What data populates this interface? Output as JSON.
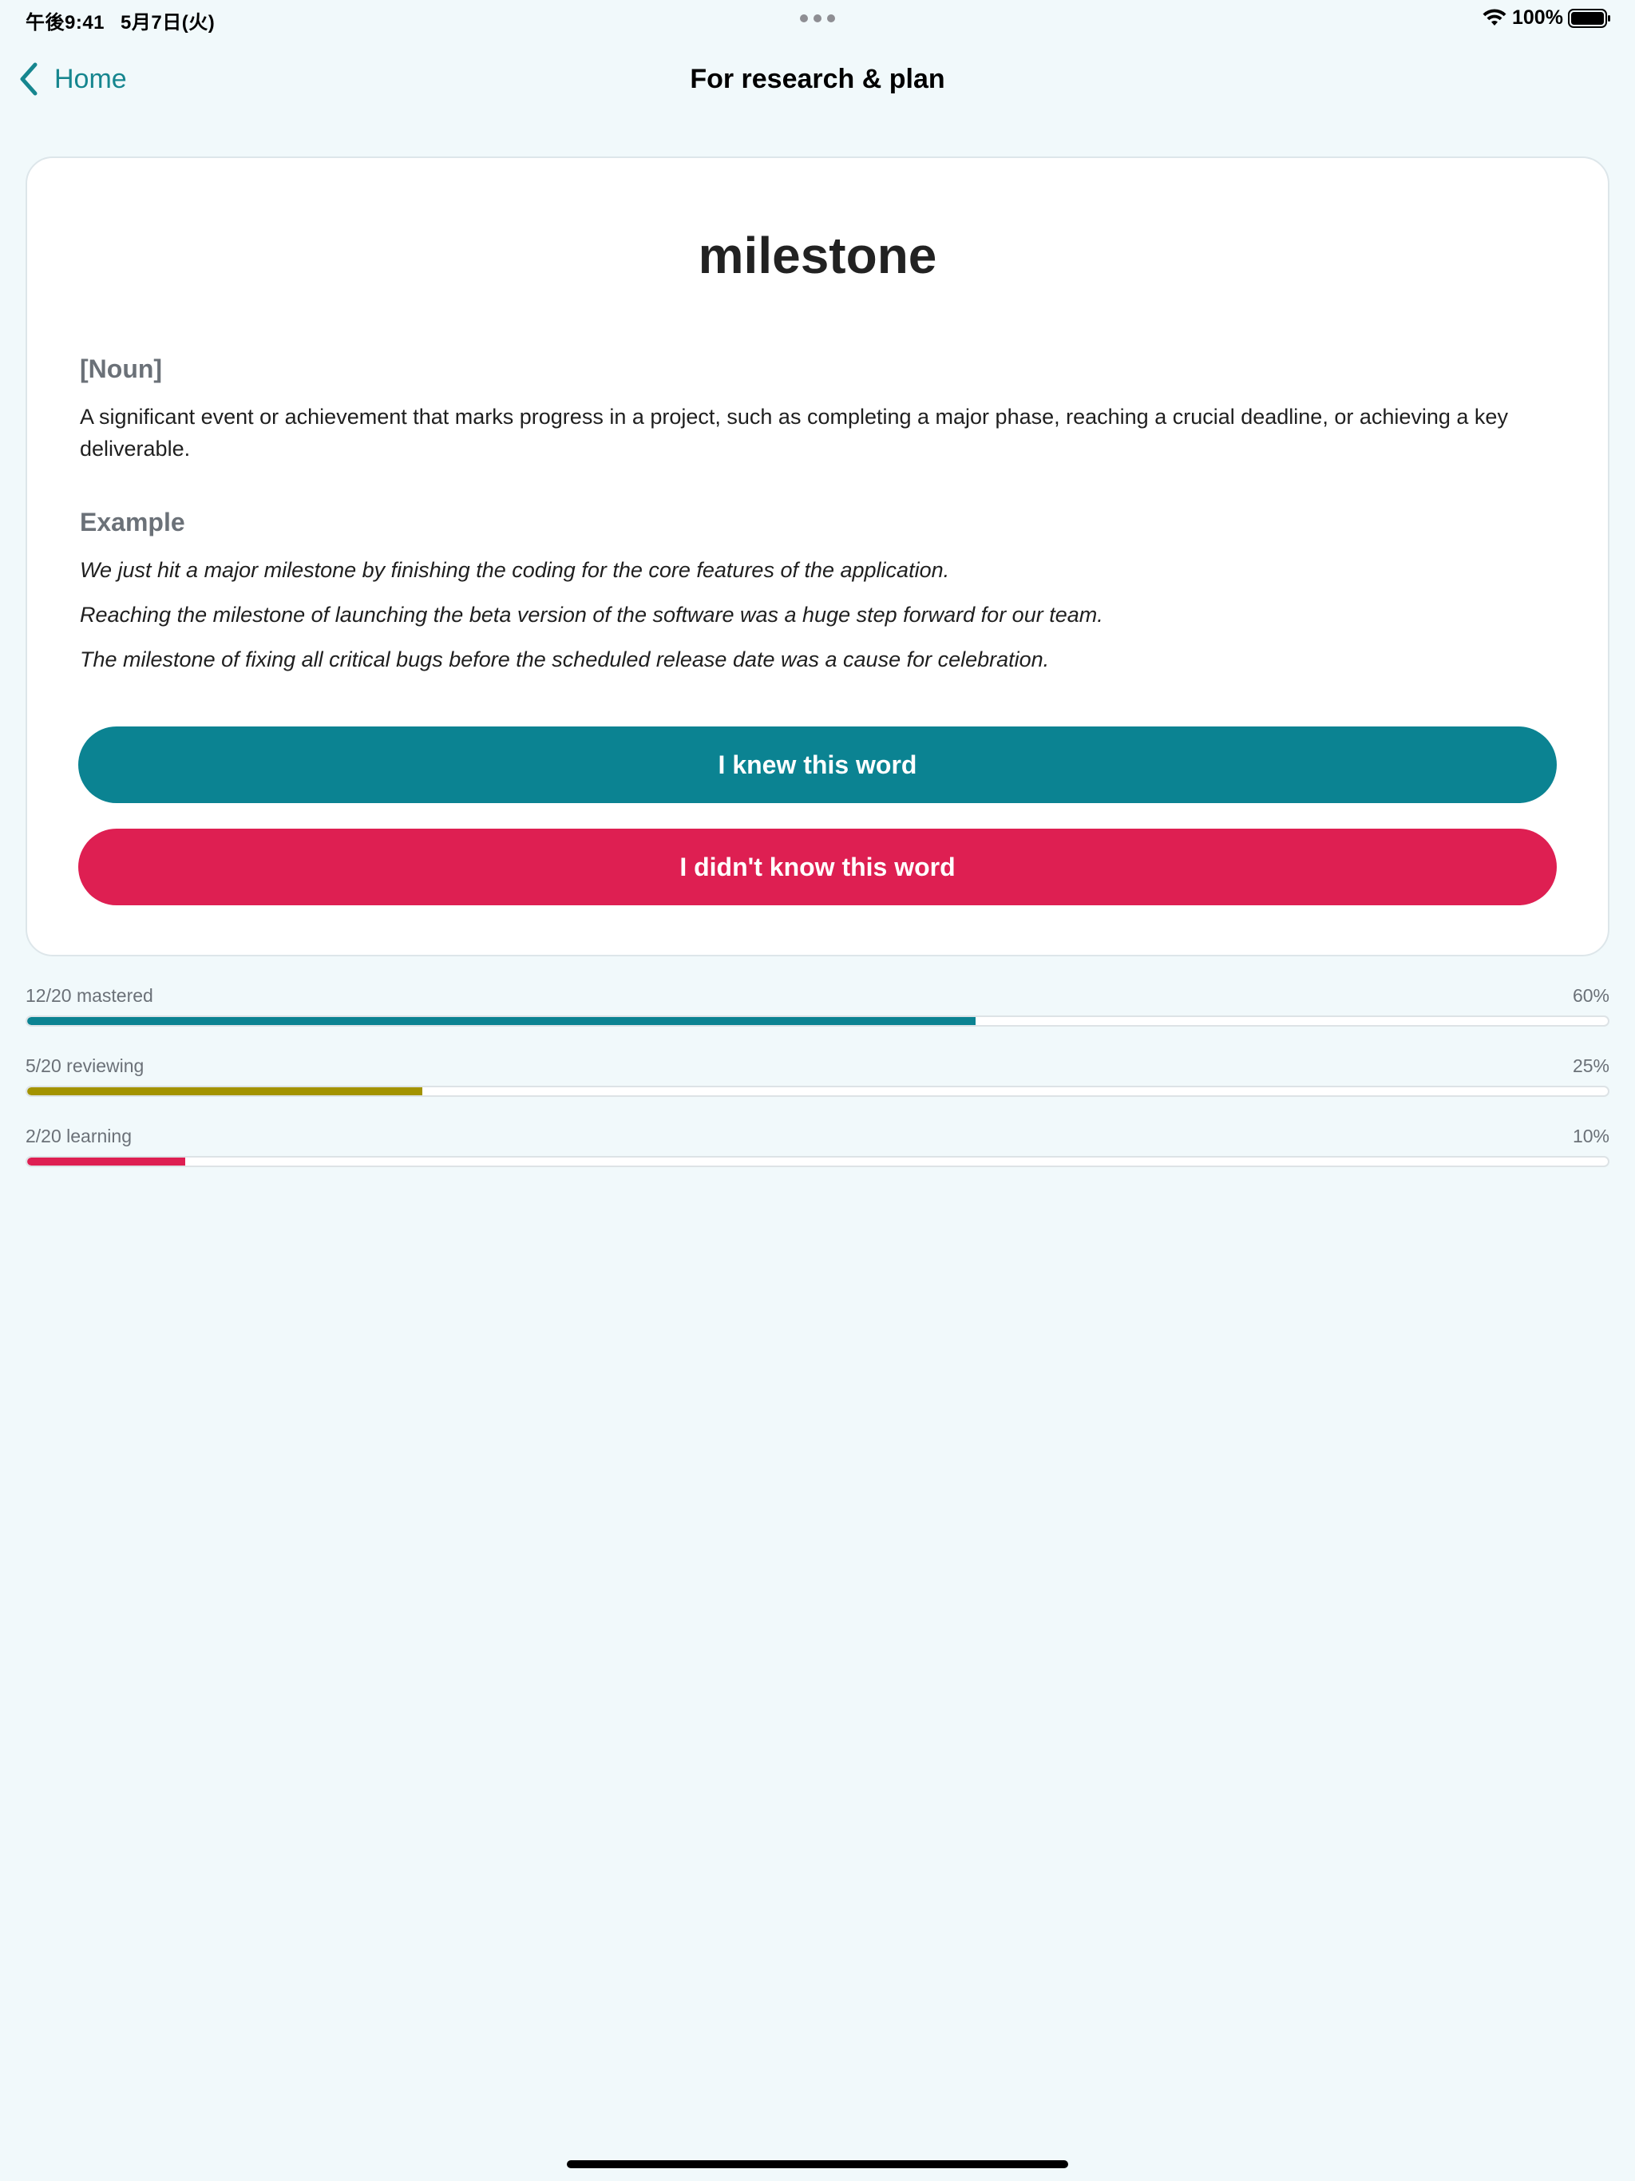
{
  "status_bar": {
    "time": "午後9:41",
    "date": "5月7日(火)",
    "battery": "100%"
  },
  "nav": {
    "back_label": "Home",
    "title": "For research & plan"
  },
  "card": {
    "word": "milestone",
    "part_of_speech": "[Noun]",
    "definition": "A significant event or achievement that marks progress in a project, such as completing a major phase, reaching a crucial deadline, or achieving a key deliverable.",
    "example_heading": "Example",
    "examples": [
      "We just hit a major milestone by finishing the coding for the core features of the application.",
      "Reaching the milestone of launching the beta version of the software was a huge step forward for our team.",
      "The milestone of fixing all critical bugs before the scheduled release date was a cause for celebration."
    ],
    "knew_button": "I knew this word",
    "didnt_know_button": "I didn't know this word"
  },
  "progress": [
    {
      "label": "12/20 mastered",
      "percent_text": "60%",
      "value": 0.6,
      "color": "#0b8392"
    },
    {
      "label": "5/20 reviewing",
      "percent_text": "25%",
      "value": 0.25,
      "color": "#a39300"
    },
    {
      "label": "2/20 learning",
      "percent_text": "10%",
      "value": 0.1,
      "color": "#de1f52"
    }
  ],
  "colors": {
    "accent": "#0b8392",
    "danger": "#de1f52",
    "background": "#f1f9fb"
  },
  "icons": [
    "wifi-icon",
    "battery-icon",
    "chevron-left-icon"
  ]
}
